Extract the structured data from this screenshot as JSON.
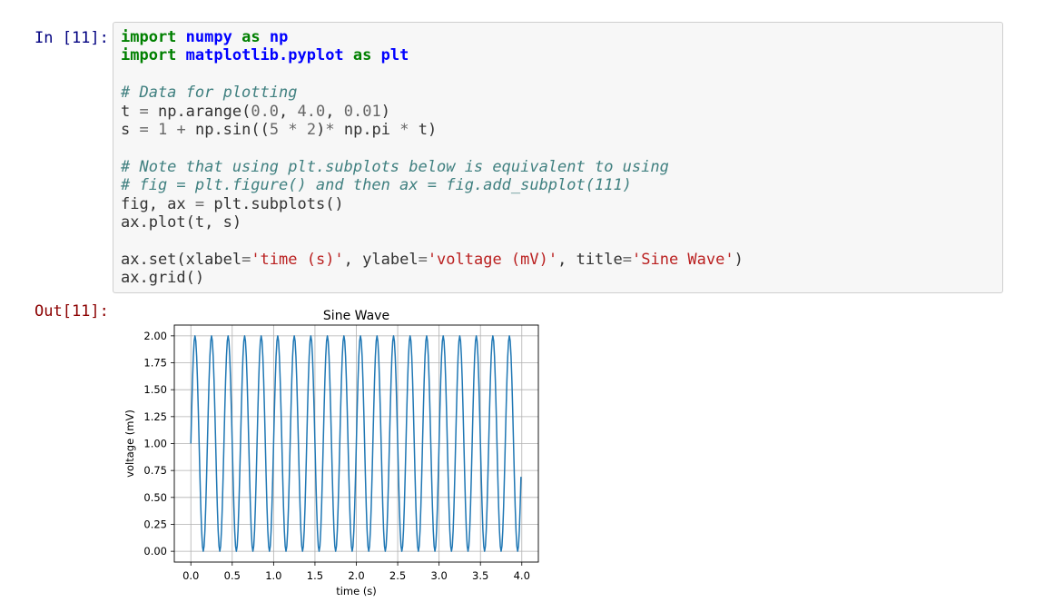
{
  "input_cell": {
    "prompt": "In [11]:",
    "code_lines": [
      [
        {
          "t": "import",
          "c": "kw"
        },
        {
          "t": " ",
          "c": ""
        },
        {
          "t": "numpy",
          "c": "nn"
        },
        {
          "t": " ",
          "c": ""
        },
        {
          "t": "as",
          "c": "kw"
        },
        {
          "t": " ",
          "c": ""
        },
        {
          "t": "np",
          "c": "nn"
        }
      ],
      [
        {
          "t": "import",
          "c": "kw"
        },
        {
          "t": " ",
          "c": ""
        },
        {
          "t": "matplotlib.pyplot",
          "c": "nn"
        },
        {
          "t": " ",
          "c": ""
        },
        {
          "t": "as",
          "c": "kw"
        },
        {
          "t": " ",
          "c": ""
        },
        {
          "t": "plt",
          "c": "nn"
        }
      ],
      [],
      [
        {
          "t": "# Data for plotting",
          "c": "cm"
        }
      ],
      [
        {
          "t": "t ",
          "c": ""
        },
        {
          "t": "=",
          "c": "op"
        },
        {
          "t": " np.arange(",
          "c": ""
        },
        {
          "t": "0.0",
          "c": "num"
        },
        {
          "t": ", ",
          "c": ""
        },
        {
          "t": "4.0",
          "c": "num"
        },
        {
          "t": ", ",
          "c": ""
        },
        {
          "t": "0.01",
          "c": "num"
        },
        {
          "t": ")",
          "c": ""
        }
      ],
      [
        {
          "t": "s ",
          "c": ""
        },
        {
          "t": "=",
          "c": "op"
        },
        {
          "t": " ",
          "c": ""
        },
        {
          "t": "1",
          "c": "num"
        },
        {
          "t": " ",
          "c": ""
        },
        {
          "t": "+",
          "c": "op"
        },
        {
          "t": " np.sin((",
          "c": ""
        },
        {
          "t": "5",
          "c": "num"
        },
        {
          "t": " ",
          "c": ""
        },
        {
          "t": "*",
          "c": "op"
        },
        {
          "t": " ",
          "c": ""
        },
        {
          "t": "2",
          "c": "num"
        },
        {
          "t": ")",
          "c": ""
        },
        {
          "t": "*",
          "c": "op"
        },
        {
          "t": " np.pi ",
          "c": ""
        },
        {
          "t": "*",
          "c": "op"
        },
        {
          "t": " t)",
          "c": ""
        }
      ],
      [],
      [
        {
          "t": "# Note that using plt.subplots below is equivalent to using",
          "c": "cm"
        }
      ],
      [
        {
          "t": "# fig = plt.figure() and then ax = fig.add_subplot(111)",
          "c": "cm"
        }
      ],
      [
        {
          "t": "fig, ax ",
          "c": ""
        },
        {
          "t": "=",
          "c": "op"
        },
        {
          "t": " plt.subplots()",
          "c": ""
        }
      ],
      [
        {
          "t": "ax.plot(t, s)",
          "c": ""
        }
      ],
      [],
      [
        {
          "t": "ax.set(xlabel",
          "c": ""
        },
        {
          "t": "=",
          "c": "op"
        },
        {
          "t": "'time (s)'",
          "c": "str"
        },
        {
          "t": ", ylabel",
          "c": ""
        },
        {
          "t": "=",
          "c": "op"
        },
        {
          "t": "'voltage (mV)'",
          "c": "str"
        },
        {
          "t": ", title",
          "c": ""
        },
        {
          "t": "=",
          "c": "op"
        },
        {
          "t": "'Sine Wave'",
          "c": "str"
        },
        {
          "t": ")",
          "c": ""
        }
      ],
      [
        {
          "t": "ax.grid()",
          "c": ""
        }
      ]
    ]
  },
  "output_cell": {
    "prompt": "Out[11]:"
  },
  "colors": {
    "line": "#1f77b4",
    "grid": "#b0b0b0",
    "axes_edge": "#000000"
  },
  "chart_data": {
    "type": "line",
    "title": "Sine Wave",
    "xlabel": "time (s)",
    "ylabel": "voltage (mV)",
    "xlim": [
      -0.2,
      4.2
    ],
    "ylim": [
      -0.1,
      2.1
    ],
    "x_ticks": [
      0.0,
      0.5,
      1.0,
      1.5,
      2.0,
      2.5,
      3.0,
      3.5,
      4.0
    ],
    "x_tick_labels": [
      "0.0",
      "0.5",
      "1.0",
      "1.5",
      "2.0",
      "2.5",
      "3.0",
      "3.5",
      "4.0"
    ],
    "y_ticks": [
      0.0,
      0.25,
      0.5,
      0.75,
      1.0,
      1.25,
      1.5,
      1.75,
      2.0
    ],
    "y_tick_labels": [
      "0.00",
      "0.25",
      "0.50",
      "0.75",
      "1.00",
      "1.25",
      "1.50",
      "1.75",
      "2.00"
    ],
    "grid": true,
    "series": [
      {
        "function": "1 + sin(10*pi*t)",
        "x_start": 0.0,
        "x_stop": 4.0,
        "x_step": 0.01
      }
    ]
  }
}
